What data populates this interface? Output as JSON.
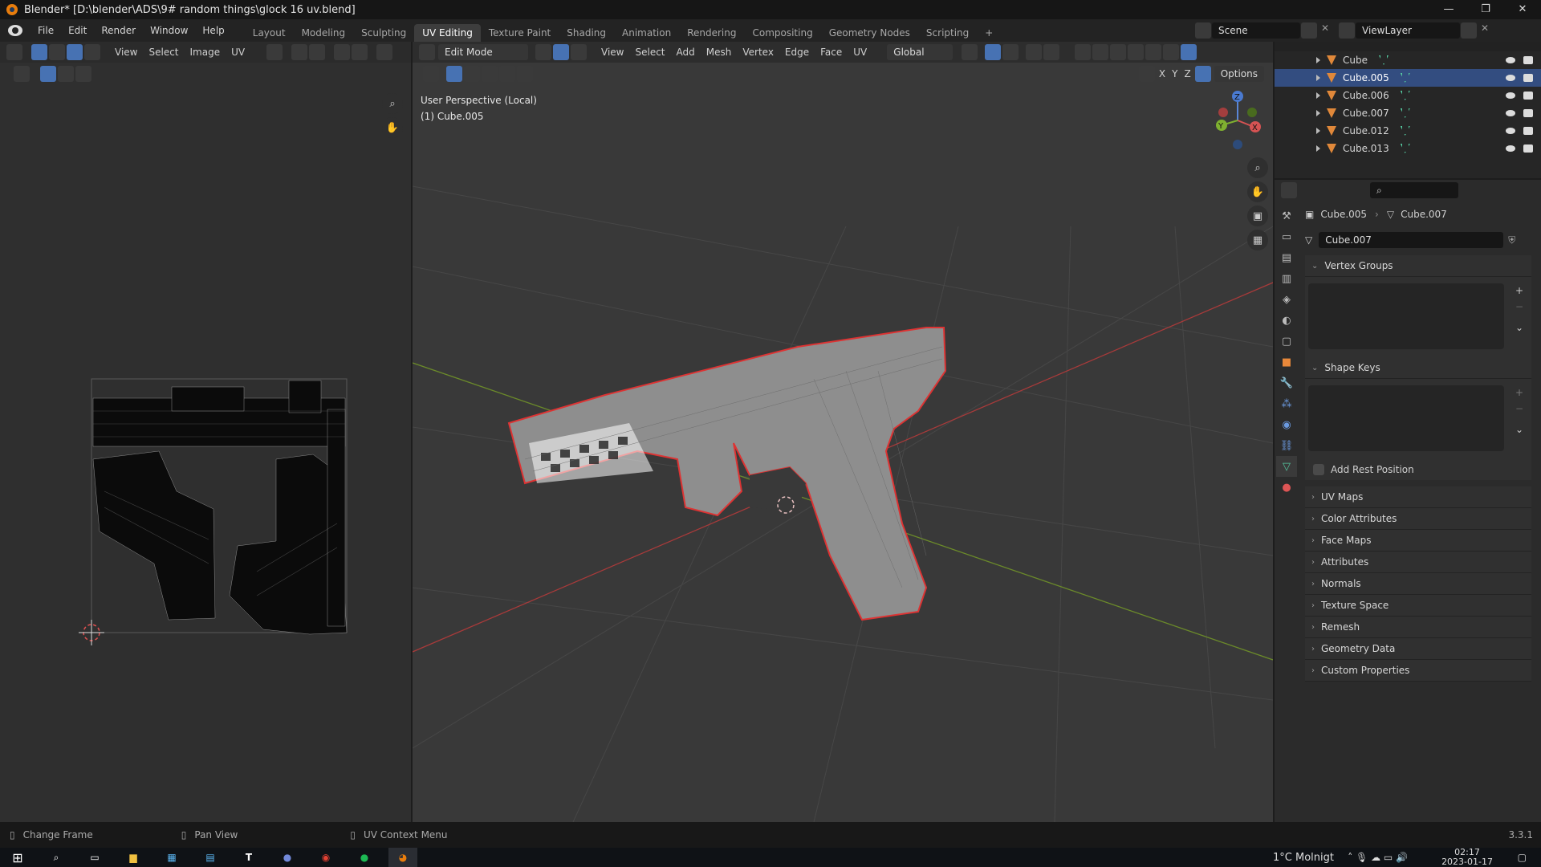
{
  "window": {
    "title": "Blender* [D:\\blender\\ADS\\9# random things\\glock 16 uv.blend]"
  },
  "menus": [
    "File",
    "Edit",
    "Render",
    "Window",
    "Help"
  ],
  "workspaces": [
    "Layout",
    "Modeling",
    "Sculpting",
    "UV Editing",
    "Texture Paint",
    "Shading",
    "Animation",
    "Rendering",
    "Compositing",
    "Geometry Nodes",
    "Scripting"
  ],
  "active_workspace": "UV Editing",
  "scene": "Scene",
  "view_layer": "ViewLayer",
  "uv_editor": {
    "menus": [
      "View",
      "Select",
      "Image",
      "UV"
    ]
  },
  "viewport": {
    "mode": "Edit Mode",
    "menus": [
      "View",
      "Select",
      "Add",
      "Mesh",
      "Vertex",
      "Edge",
      "Face",
      "UV"
    ],
    "orientation": "Global",
    "options": "Options",
    "axes": [
      "X",
      "Y",
      "Z"
    ],
    "info_line1": "User Perspective (Local)",
    "info_line2": "(1) Cube.005",
    "gizmo_labels": [
      "Z",
      "Y",
      "X"
    ]
  },
  "outliner": {
    "items": [
      {
        "name": "Cube",
        "selected": false
      },
      {
        "name": "Cube.005",
        "selected": true
      },
      {
        "name": "Cube.006",
        "selected": false
      },
      {
        "name": "Cube.007",
        "selected": false
      },
      {
        "name": "Cube.012",
        "selected": false
      },
      {
        "name": "Cube.013",
        "selected": false
      }
    ]
  },
  "properties": {
    "breadcrumb_object": "Cube.005",
    "breadcrumb_data": "Cube.007",
    "datablock": "Cube.007",
    "vertex_groups": "Vertex Groups",
    "shape_keys": "Shape Keys",
    "add_rest_position": "Add Rest Position",
    "panels": [
      "UV Maps",
      "Color Attributes",
      "Face Maps",
      "Attributes",
      "Normals",
      "Texture Space",
      "Remesh",
      "Geometry Data",
      "Custom Properties"
    ]
  },
  "status": {
    "items": [
      "Change Frame",
      "Pan View",
      "UV Context Menu"
    ],
    "version": "3.3.1"
  },
  "taskbar": {
    "weather": "1°C  Molnigt",
    "time": "02:17",
    "date": "2023-01-17"
  },
  "colors": {
    "accent": "#4772b3",
    "selected_row": "#334d80",
    "orange": "#e87d0d"
  }
}
